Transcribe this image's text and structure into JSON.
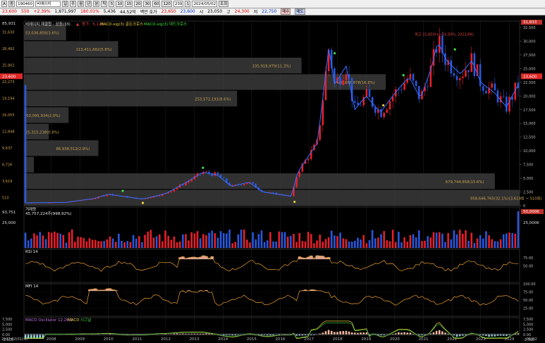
{
  "toolbar": {
    "items": [
      "A",
      "종",
      "190460",
      "비에이치",
      "일",
      "주",
      "월",
      "년",
      "분",
      "틱",
      "5",
      "10",
      "15",
      "20",
      "30",
      "60",
      "120",
      "239",
      "1"
    ],
    "date": "2024/05/02",
    "query_label": "조회"
  },
  "quote": {
    "price": "23,600",
    "change": "550",
    "change_pct": "+2.39%",
    "volume": "1,871,997",
    "vol_ratio": "180.01%",
    "turnover": "5,436",
    "mkt_cap": "44.52억",
    "label_cap": "백만 호가",
    "bid": "23,650",
    "ask": "23,600",
    "open_label": "시",
    "open": "23,050",
    "high_label": "고",
    "high": "24,300",
    "low_label": "저",
    "low": "22,750",
    "buy_label": "매수",
    "sell_label": "매도"
  },
  "colors": {
    "up": "#e8202a",
    "down": "#2858e0",
    "ma": "#3a6cff",
    "orange": "#f0a030",
    "fill": "#f2b59a"
  },
  "price_panel": {
    "legend": [
      "비에이치 재결합 : 삼중(33)",
      "▲",
      "종가 : 5,120",
      "MACD-sig(3) 골든크로스",
      "MACD-sig(3) 데드크로스"
    ],
    "left_top": "85,931",
    "right_top_tag": "31,833",
    "y_left": [
      "31,630",
      "28,492",
      "25,902",
      "22,273",
      "19,194",
      "16,055",
      "12,848",
      "9,637",
      "6,726",
      "3,619",
      "510"
    ],
    "y_right": [
      "32,500",
      "30,000",
      "27,500",
      "25,000",
      "22,500",
      "20,000",
      "17,500",
      "15,000",
      "12,500",
      "10,000",
      "7,500",
      "5,000",
      "2,500",
      "0"
    ],
    "current_tag": "23,600",
    "max_annotation": "최고 31,650(+~33.93%, 2021/06)",
    "profile": [
      {
        "label": "53,036,858(3.6%)",
        "w": 0.085
      },
      {
        "label": "113,411,882(5.8%)",
        "w": 0.19
      },
      {
        "label": "335,918,979(11.3%)",
        "w": 0.56
      },
      {
        "label": "488,668,878(16.8%)",
        "w": 0.73
      },
      {
        "label": "253,572,191(8.6%)",
        "w": 0.43
      },
      {
        "label": "53,095,934(2.0%)",
        "w": 0.09
      },
      {
        "label": "25,315,238(0.8%)",
        "w": 0.05
      },
      {
        "label": "86,938,512(2.9%)",
        "w": 0.15
      },
      {
        "label": "",
        "w": 0.02
      },
      {
        "label": "679,744,858(15.6%)",
        "w": 0.95
      },
      {
        "label": "958,646,765(32.1%)(3,619원 ~ 510원)",
        "w": 1.0
      }
    ]
  },
  "volume_panel": {
    "label": "거래량",
    "value": "45,757,224주(998.92%)",
    "left_top": "93,751",
    "left_mid": "25,000",
    "right_top": "50,000K",
    "right_mid": "25,000K"
  },
  "rsi_panel": {
    "label": "RSI 14",
    "y": [
      "75.00",
      "50.00"
    ]
  },
  "mfi_panel": {
    "label": "MFI 14",
    "y": [
      "100.00",
      "75.00",
      "50.00",
      "25.00"
    ]
  },
  "macd_panel": {
    "label": "MACD Oscillator 12,26,9",
    "label2": "MACD",
    "label3": "시그널",
    "y": [
      "7,500",
      "5,000",
      "2,500",
      "0.00",
      "-2,500"
    ]
  },
  "x_axis": {
    "first_date": "2007/02/01(목)",
    "years": [
      "2008",
      "2009",
      "2010",
      "2011",
      "2012",
      "2013",
      "2014",
      "2015",
      "2016",
      "2017",
      "2018",
      "2019",
      "2020",
      "2021",
      "2022",
      "2023",
      "2024"
    ],
    "last": "05/02"
  },
  "chart_data": {
    "type": "candlestick",
    "title": "비에이치",
    "price_anchors": [
      [
        2007.1,
        510
      ],
      [
        2008.5,
        600
      ],
      [
        2009.5,
        1300
      ],
      [
        2010.0,
        2100
      ],
      [
        2010.6,
        1600
      ],
      [
        2011.2,
        1200
      ],
      [
        2012.0,
        2200
      ],
      [
        2012.8,
        4500
      ],
      [
        2013.3,
        6100
      ],
      [
        2013.8,
        5600
      ],
      [
        2014.3,
        3500
      ],
      [
        2014.9,
        4300
      ],
      [
        2015.4,
        2500
      ],
      [
        2016.4,
        1700
      ],
      [
        2016.6,
        6000
      ],
      [
        2017.3,
        11500
      ],
      [
        2017.7,
        29000
      ],
      [
        2017.9,
        22000
      ],
      [
        2018.3,
        25500
      ],
      [
        2018.6,
        17500
      ],
      [
        2019.0,
        20000
      ],
      [
        2019.5,
        17000
      ],
      [
        2020.0,
        20500
      ],
      [
        2020.5,
        23500
      ],
      [
        2020.9,
        19500
      ],
      [
        2021.3,
        25500
      ],
      [
        2021.5,
        30000
      ],
      [
        2021.8,
        26500
      ],
      [
        2022.3,
        24000
      ],
      [
        2022.7,
        26500
      ],
      [
        2023.0,
        22500
      ],
      [
        2023.5,
        20500
      ],
      [
        2023.9,
        18000
      ],
      [
        2024.3,
        22000
      ]
    ],
    "current_price": 23600
  }
}
